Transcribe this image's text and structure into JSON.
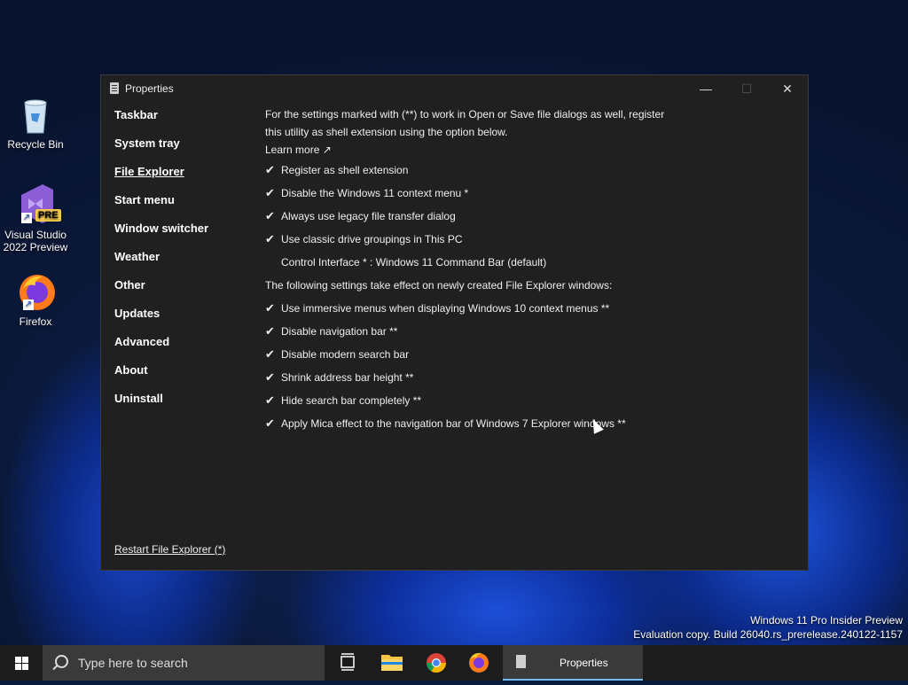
{
  "desktop": {
    "icons": [
      {
        "label": "Recycle Bin"
      },
      {
        "label_line1": "Visual Studio",
        "label_line2": "2022 Preview",
        "badge": "PRE"
      },
      {
        "label": "Firefox"
      }
    ],
    "watermark_line1": "Windows 11 Pro Insider Preview",
    "watermark_line2": "Evaluation copy. Build 26040.rs_prerelease.240122-1157"
  },
  "window": {
    "title": "Properties",
    "controls": {
      "minimize": "—",
      "maximize": "☐",
      "close": "✕"
    },
    "nav": [
      "Taskbar",
      "System tray",
      "File Explorer",
      "Start menu",
      "Window switcher",
      "Weather",
      "Other",
      "Updates",
      "Advanced",
      "About",
      "Uninstall"
    ],
    "active_nav": "File Explorer",
    "intro_line1": "For the settings marked with (**) to work in Open or Save file dialogs as well, register",
    "intro_line2": "this utility as shell extension using the option below.",
    "learn_more": "Learn more ↗",
    "options_group1": [
      "Register as shell extension",
      "Disable the Windows 11 context menu *",
      "Always use legacy file transfer dialog",
      "Use classic drive groupings in This PC"
    ],
    "control_interface": "Control Interface * : Windows 11 Command Bar (default)",
    "section_heading": "The following settings take effect on newly created File Explorer windows:",
    "options_group2": [
      "Use immersive menus when displaying Windows 10 context menus **",
      "Disable navigation bar **",
      "Disable modern search bar",
      "Shrink address bar height **",
      "Hide search bar completely **",
      "Apply Mica effect to the navigation bar of Windows 7 Explorer windows **"
    ],
    "check_glyph": "✔",
    "restart_link": "Restart File Explorer (*)"
  },
  "taskbar": {
    "search_placeholder": "Type here to search",
    "active_app": "Properties",
    "accent": "#76b9ed"
  }
}
